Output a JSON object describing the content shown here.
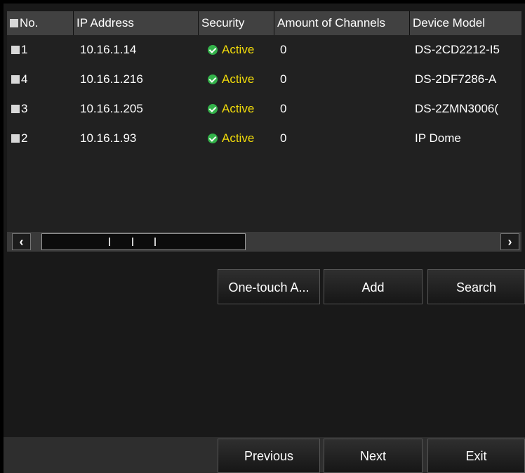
{
  "table": {
    "headers": {
      "no": "No.",
      "ip": "IP Address",
      "security": "Security",
      "channels": "Amount of Channels",
      "model": "Device Model"
    },
    "rows": [
      {
        "no": "1",
        "ip": "10.16.1.14",
        "security": "Active",
        "channels": "0",
        "model": "DS-2CD2212-I5"
      },
      {
        "no": "4",
        "ip": "10.16.1.216",
        "security": "Active",
        "channels": "0",
        "model": "DS-2DF7286-A"
      },
      {
        "no": "3",
        "ip": "10.16.1.205",
        "security": "Active",
        "channels": "0",
        "model": "DS-2ZMN3006("
      },
      {
        "no": "2",
        "ip": "10.16.1.93",
        "security": "Active",
        "channels": "0",
        "model": "IP Dome"
      }
    ]
  },
  "scrollbar": {
    "left_arrow": "‹",
    "right_arrow": "›"
  },
  "actions": {
    "one_touch": "One-touch A...",
    "add": "Add",
    "search": "Search"
  },
  "footer": {
    "previous": "Previous",
    "next": "Next",
    "exit": "Exit"
  },
  "colors": {
    "active_text": "#f2dc0a",
    "active_icon": "#33b24a",
    "header_bg": "#414141",
    "panel_bg": "#191919"
  }
}
